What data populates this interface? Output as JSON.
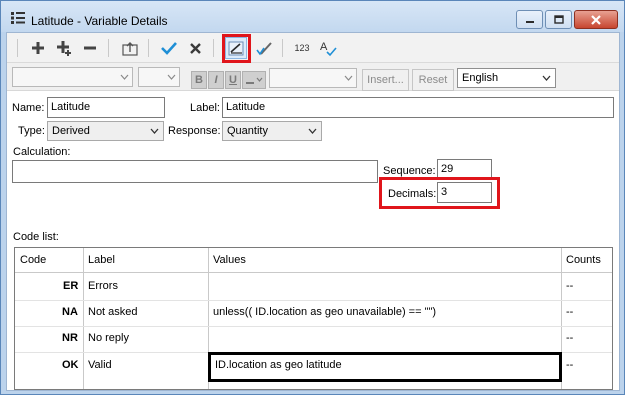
{
  "window": {
    "title": "Latitude - Variable Details",
    "minimize_icon": "minimize-icon",
    "maximize_icon": "maximize-icon",
    "close_icon": "close-icon"
  },
  "toolbar": {
    "icons": [
      "add-icon",
      "add-sub-icon",
      "remove-icon",
      "move-up-icon",
      "accept-icon",
      "cancel-icon",
      "set-decimals-icon",
      "edit-check-icon",
      "number-format-icon",
      "spellcheck-icon"
    ],
    "number_format_label": "123"
  },
  "formatbar": {
    "bold_label": "B",
    "italic_label": "I",
    "underline_label": "U",
    "insert_label": "Insert...",
    "reset_label": "Reset",
    "language_value": "English"
  },
  "form": {
    "name_label": "Name:",
    "name_value": "Latitude",
    "label_label": "Label:",
    "label_value": "Latitude",
    "type_label": "Type:",
    "type_value": "Derived",
    "response_label": "Response:",
    "response_value": "Quantity",
    "calculation_label": "Calculation:",
    "calculation_value": "",
    "sequence_label": "Sequence:",
    "sequence_value": "29",
    "decimals_label": "Decimals:",
    "decimals_value": "3"
  },
  "codelist": {
    "title": "Code list:",
    "headers": {
      "code": "Code",
      "label": "Label",
      "values": "Values",
      "counts": "Counts"
    },
    "rows": [
      {
        "code": "ER",
        "label": "Errors",
        "values": "",
        "counts": "--"
      },
      {
        "code": "NA",
        "label": "Not asked",
        "values": "unless(( ID.location as geo unavailable) == \"\")",
        "counts": "--"
      },
      {
        "code": "NR",
        "label": "No reply",
        "values": "",
        "counts": "--"
      },
      {
        "code": "OK",
        "label": "Valid",
        "values": "ID.location as geo latitude",
        "counts": "--"
      }
    ]
  },
  "colors": {
    "accent_highlight": "#e0151b",
    "check": "#1f8fd6",
    "cancel": "#3a3a3a"
  }
}
